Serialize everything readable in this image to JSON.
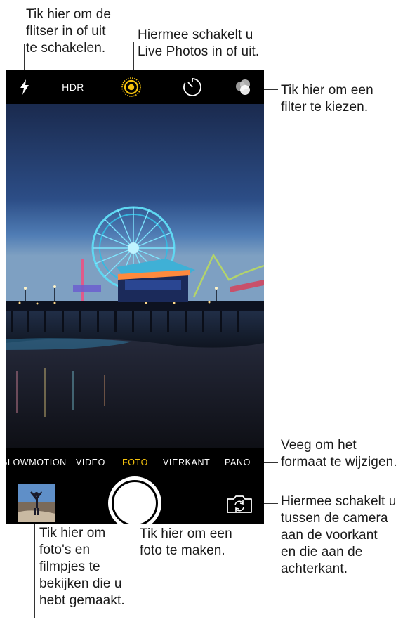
{
  "callouts": {
    "flash": "Tik hier om de\nflitser in of uit\nte schakelen.",
    "live": "Hiermee schakelt u\nLive Photos in of uit.",
    "filter": "Tik hier om een\nfilter te kiezen.",
    "swipe": "Veeg om het\nformaat te wijzigen.",
    "switch_camera": "Hiermee schakelt u\ntussen de camera\naan de voorkant\nen die aan de\nachterkant.",
    "shutter": "Tik hier om een\nfoto te maken.",
    "thumbnail": "Tik hier om\nfoto's en\nfilmpjes te\nbekijken die u\nhebt gemaakt."
  },
  "camera": {
    "top_bar": {
      "flash_icon": "lightning-bolt",
      "hdr_label": "HDR",
      "live_icon": "live-photos-rings",
      "live_color": "#f5c20d",
      "timer_icon": "timer",
      "filter_icon": "overlapping-circles"
    },
    "modes": [
      "SLOWMOTION",
      "VIDEO",
      "FOTO",
      "VIERKANT",
      "PANO"
    ],
    "active_mode": "FOTO",
    "active_color": "#f5c20d"
  }
}
